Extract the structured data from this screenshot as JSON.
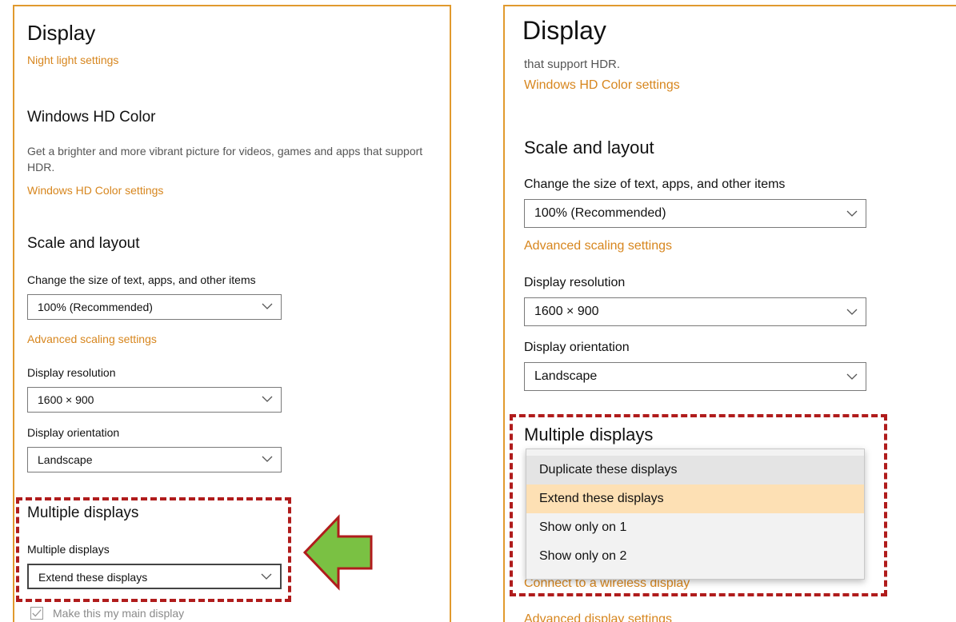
{
  "left": {
    "title": "Display",
    "night_light_link": "Night light settings",
    "hd_color": {
      "heading": "Windows HD Color",
      "description": "Get a brighter and more vibrant picture for videos, games and apps that support HDR.",
      "link": "Windows HD Color settings"
    },
    "scale": {
      "heading": "Scale and layout",
      "size_label": "Change the size of text, apps, and other items",
      "size_value": "100% (Recommended)",
      "advanced_link": "Advanced scaling settings",
      "resolution_label": "Display resolution",
      "resolution_value": "1600 × 900",
      "orientation_label": "Display orientation",
      "orientation_value": "Landscape"
    },
    "multiple": {
      "heading": "Multiple displays",
      "label": "Multiple displays",
      "value": "Extend these displays",
      "main_display_checkbox": "Make this my main display"
    }
  },
  "right": {
    "title": "Display",
    "hdr_tail": "that support HDR.",
    "hd_color_link": "Windows HD Color settings",
    "scale": {
      "heading": "Scale and layout",
      "size_label": "Change the size of text, apps, and other items",
      "size_value": "100% (Recommended)",
      "advanced_link": "Advanced scaling settings",
      "resolution_label": "Display resolution",
      "resolution_value": "1600 × 900",
      "orientation_label": "Display orientation",
      "orientation_value": "Landscape"
    },
    "multiple": {
      "heading": "Multiple displays",
      "options": [
        "Duplicate these displays",
        "Extend these displays",
        "Show only on 1",
        "Show only on 2"
      ],
      "selected_option": "Extend these displays",
      "wireless_link": "Connect to a wireless display",
      "advanced_display_link": "Advanced display settings"
    }
  },
  "colors": {
    "accent_link": "#d7861e",
    "panel_border": "#e19a2e",
    "highlight_dash": "#b01c1c",
    "arrow_fill": "#7ac143",
    "arrow_stroke": "#b01c1c",
    "menu_selected": "#fde0b4"
  },
  "icons": {
    "dropdown": "chevron-down-icon",
    "pointer": "arrow-left-icon",
    "checkbox": "checkmark-icon"
  }
}
